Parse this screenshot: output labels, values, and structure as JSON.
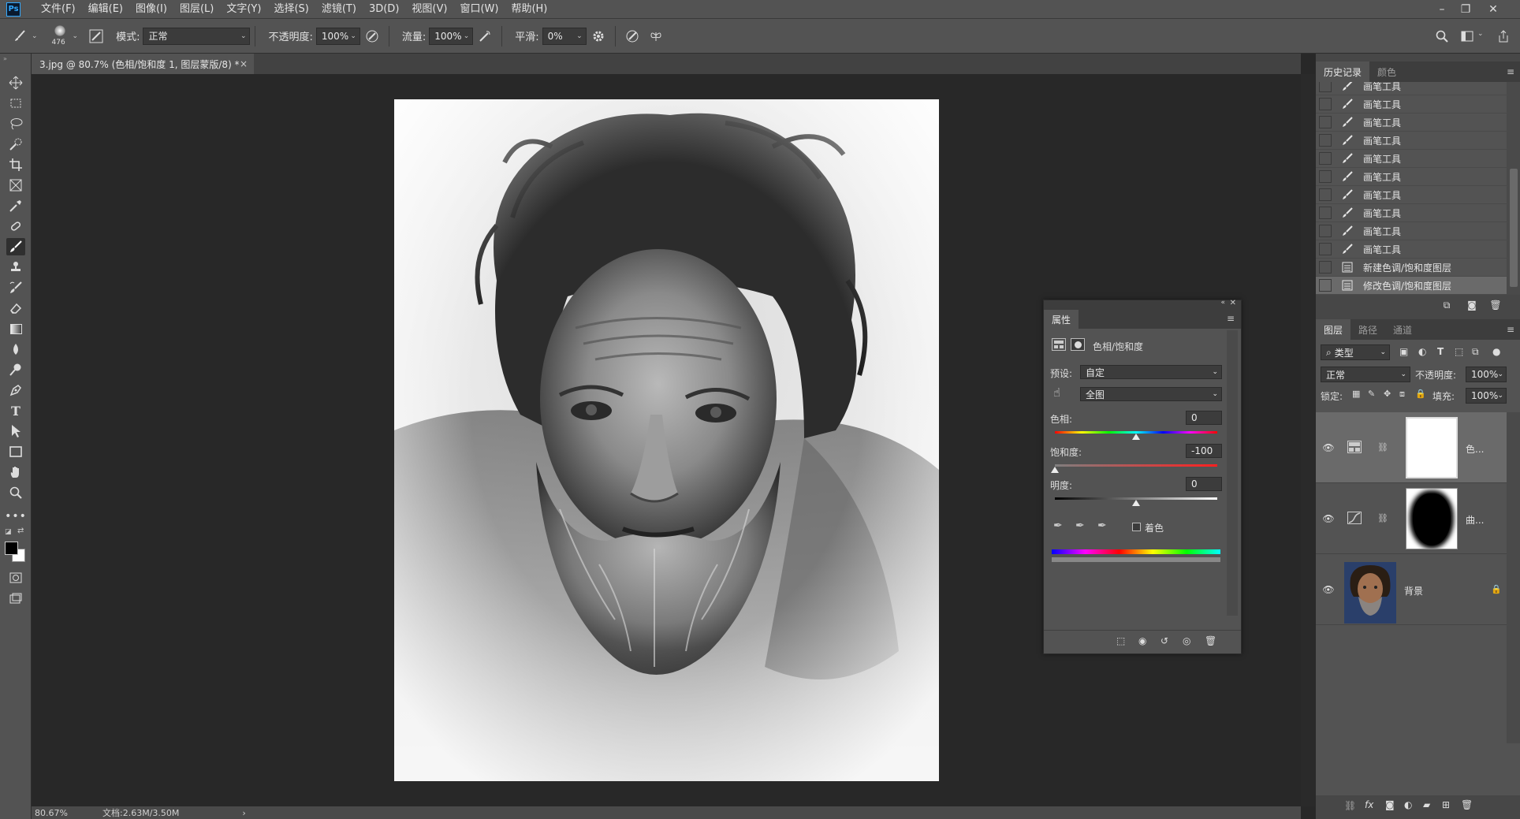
{
  "app": {
    "logo": "Ps"
  },
  "menu": [
    "文件(F)",
    "编辑(E)",
    "图像(I)",
    "图层(L)",
    "文字(Y)",
    "选择(S)",
    "滤镜(T)",
    "3D(D)",
    "视图(V)",
    "窗口(W)",
    "帮助(H)"
  ],
  "window_controls": [
    "minimize-icon",
    "restore-icon",
    "close-icon"
  ],
  "options": {
    "brush_size": "476",
    "mode_label": "模式:",
    "mode_value": "正常",
    "opacity_label": "不透明度:",
    "opacity_value": "100%",
    "flow_label": "流量:",
    "flow_value": "100%",
    "smooth_label": "平滑:",
    "smooth_value": "0%"
  },
  "document": {
    "tab_title": "3.jpg @ 80.7% (色相/饱和度 1, 图层蒙版/8) *",
    "tab_close": "×",
    "zoom": "80.67%",
    "doc_info": "文档:2.63M/3.50M",
    "status_arrow": "›"
  },
  "history_panel": {
    "tabs": [
      "历史记录",
      "颜色"
    ],
    "items": [
      {
        "label": "画笔工具",
        "icon": "brush-icon"
      },
      {
        "label": "画笔工具",
        "icon": "brush-icon"
      },
      {
        "label": "画笔工具",
        "icon": "brush-icon"
      },
      {
        "label": "画笔工具",
        "icon": "brush-icon"
      },
      {
        "label": "画笔工具",
        "icon": "brush-icon"
      },
      {
        "label": "画笔工具",
        "icon": "brush-icon"
      },
      {
        "label": "画笔工具",
        "icon": "brush-icon"
      },
      {
        "label": "画笔工具",
        "icon": "brush-icon"
      },
      {
        "label": "画笔工具",
        "icon": "brush-icon"
      },
      {
        "label": "画笔工具",
        "icon": "brush-icon"
      },
      {
        "label": "新建色调/饱和度图层",
        "icon": "adjustment-layer-icon"
      },
      {
        "label": "修改色调/饱和度图层",
        "icon": "adjustment-layer-icon"
      }
    ]
  },
  "layers_panel": {
    "tabs": [
      "图层",
      "路径",
      "通道"
    ],
    "filter_kind": "类型",
    "blend_mode": "正常",
    "opacity_label": "不透明度:",
    "opacity_value": "100%",
    "lock_label": "锁定:",
    "fill_label": "填充:",
    "fill_value": "100%",
    "layers": [
      {
        "name": "色...",
        "type": "hue-saturation",
        "mask": "white"
      },
      {
        "name": "曲...",
        "type": "curves",
        "mask": "black-blob"
      },
      {
        "name": "背景",
        "type": "background",
        "locked": true
      }
    ]
  },
  "properties_panel": {
    "tab": "属性",
    "adjustment_name": "色相/饱和度",
    "preset_label": "预设:",
    "preset_value": "自定",
    "channel_value": "全图",
    "hue_label": "色相:",
    "hue_value": "0",
    "saturation_label": "饱和度:",
    "saturation_value": "-100",
    "lightness_label": "明度:",
    "lightness_value": "0",
    "colorize_label": "着色",
    "hue_level": 0,
    "saturation_level": -100,
    "lightness_level": 0
  },
  "colors": {
    "accent": "#31a8ff",
    "panel": "#535353",
    "dark": "#282828"
  }
}
